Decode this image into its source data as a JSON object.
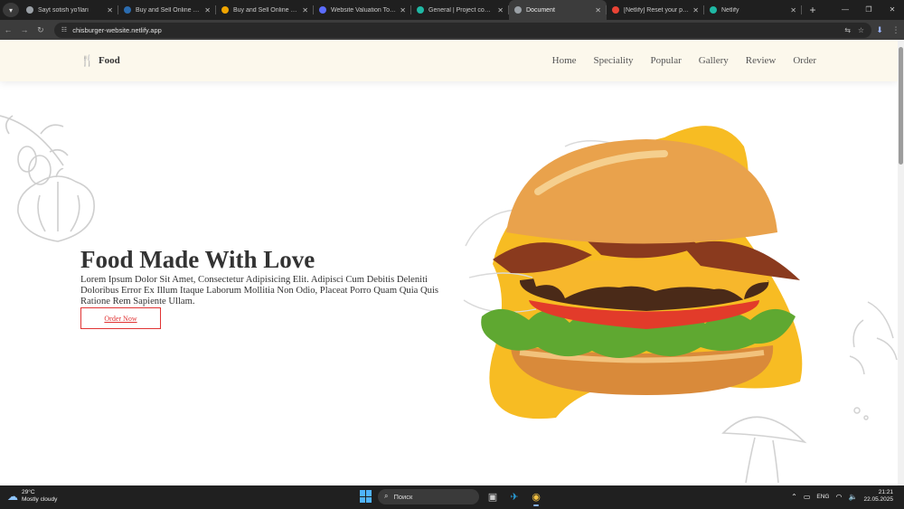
{
  "browser": {
    "tabs": [
      {
        "title": "Sayt sotish yo'llari",
        "favicon_color": "#9aa0a6"
      },
      {
        "title": "Buy and Sell Online Busin",
        "favicon_color": "#2b6cb0"
      },
      {
        "title": "Buy and Sell Online Busin",
        "favicon_color": "#f0a500"
      },
      {
        "title": "Website Valuation Tool - ",
        "favicon_color": "#5b6cff"
      },
      {
        "title": "General | Project configu",
        "favicon_color": "#1fb8a4"
      },
      {
        "title": "Document",
        "favicon_color": "#9aa0a6"
      },
      {
        "title": "[Netlify] Reset your passw",
        "favicon_color": "#ea4335"
      },
      {
        "title": "Netlify",
        "favicon_color": "#1fb8a4"
      }
    ],
    "active_tab_index": 5,
    "new_tab_symbol": "+",
    "url": "chisburger-website.netlify.app"
  },
  "site": {
    "logo_text": "Food",
    "nav": [
      "Home",
      "Speciality",
      "Popular",
      "Gallery",
      "Review",
      "Order"
    ],
    "hero": {
      "title": "Food Made With Love",
      "text": "Lorem Ipsum Dolor Sit Amet, Consectetur Adipisicing Elit. Adipisci Cum Debitis Deleniti Doloribus Error Ex Illum Itaque Laborum Mollitia Non Odio, Placeat Porro Quam Quia Quis Ratione Rem Sapiente Ullam.",
      "button": "Order Now"
    },
    "colors": {
      "accent": "#e03333",
      "header_bg": "#fcf8ec",
      "blob": "#f7bc23"
    }
  },
  "taskbar": {
    "weather_temp": "29°C",
    "weather_desc": "Mostly cloudy",
    "search_placeholder": "Поиск",
    "language": "ENG",
    "time": "21:21",
    "date": "22.05.2025"
  }
}
